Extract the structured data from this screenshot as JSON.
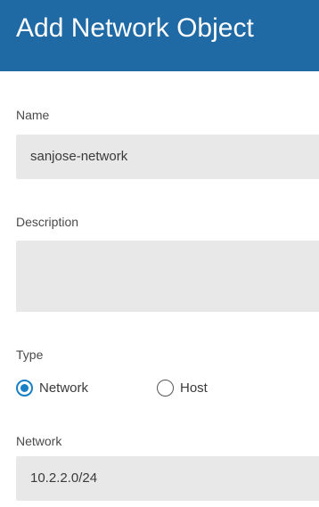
{
  "dialog": {
    "title": "Add Network Object"
  },
  "fields": {
    "name": {
      "label": "Name",
      "value": "sanjose-network"
    },
    "description": {
      "label": "Description",
      "value": ""
    },
    "type": {
      "label": "Type",
      "options": [
        {
          "label": "Network",
          "selected": true
        },
        {
          "label": "Host",
          "selected": false
        }
      ]
    },
    "network": {
      "label": "Network",
      "value": "10.2.2.0/24"
    }
  },
  "colors": {
    "header_bg": "#1f69a4",
    "input_bg": "#e8e8e8",
    "radio_accent": "#1a7fc4"
  }
}
